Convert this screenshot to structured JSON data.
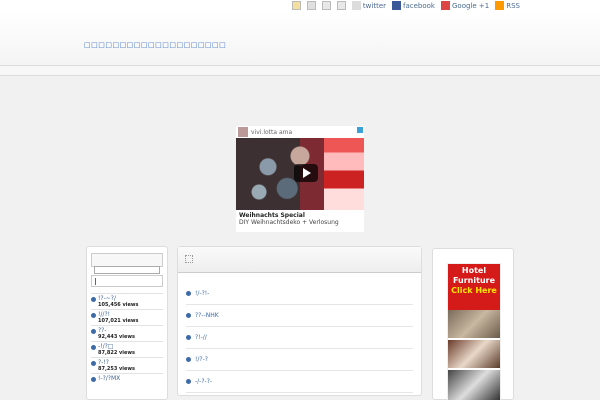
{
  "topbar": {
    "links": [
      {
        "label": "twitter",
        "icon": "twitter-icon"
      },
      {
        "label": "facebook",
        "icon": "facebook-icon"
      },
      {
        "label": "Google +1",
        "icon": "google-plus-icon"
      },
      {
        "label": "RSS",
        "icon": "rss-icon"
      }
    ]
  },
  "header": {
    "site_title": "□□□□□□□□□□□□□□□□□□□□"
  },
  "ad": {
    "account": "vivi.lotta ama",
    "title": "Weihnachts Special",
    "description": "DIY Weihnachtsdeko + Verlosung"
  },
  "left_sidebar": {
    "search_placeholder": "",
    "ranking": [
      {
        "title": "!?-~?/",
        "views": "105,456 views"
      },
      {
        "title": "!//?!",
        "views": "107,021 views"
      },
      {
        "title": "??-",
        "views": "92,443 views"
      },
      {
        "title": "-!/?□",
        "views": "87,822 views"
      },
      {
        "title": "?-!?",
        "views": "87,253 views"
      },
      {
        "title": "!-?/?MX",
        "views": ""
      }
    ]
  },
  "main": {
    "items": [
      "!/-?!-",
      "??--NHK",
      "?!-//",
      "!/?-?",
      "-/-?-?-"
    ]
  },
  "right_sidebar": {
    "ad_lines": [
      "Hotel",
      "Furniture"
    ],
    "ad_cta": "Click Here"
  }
}
